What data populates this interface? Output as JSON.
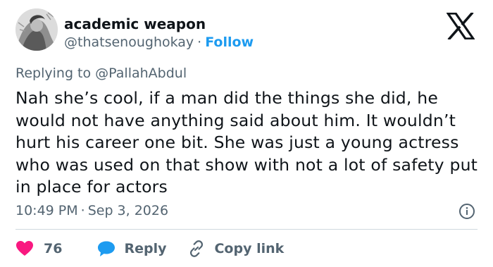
{
  "author": {
    "display_name": "academic weapon",
    "handle": "@thatsenoughokay",
    "separator": "·",
    "follow_label": "Follow"
  },
  "reply_context": {
    "prefix": "Replying to",
    "target": "@PallahAbdul"
  },
  "tweet": {
    "text": "Nah she’s cool, if a man did the things she did, he would not have anything said about him. It wouldn’t hurt his career one bit. She was just a young actress who was used on that show with not a lot of safety put in place for actors",
    "time": "10:49 PM",
    "separator": "·",
    "date": "Sep 3, 2026"
  },
  "actions": {
    "like_count": "76",
    "reply_label": "Reply",
    "copy_link_label": "Copy link"
  },
  "icons": {
    "logo": "x-logo-icon",
    "info": "info-icon",
    "like": "heart-icon",
    "reply": "speech-bubble-icon",
    "copy_link": "link-icon"
  },
  "colors": {
    "text": "#0f1419",
    "secondary": "#536471",
    "accent": "#1d9bf0",
    "like": "#f91880",
    "divider": "#cfd9de"
  }
}
